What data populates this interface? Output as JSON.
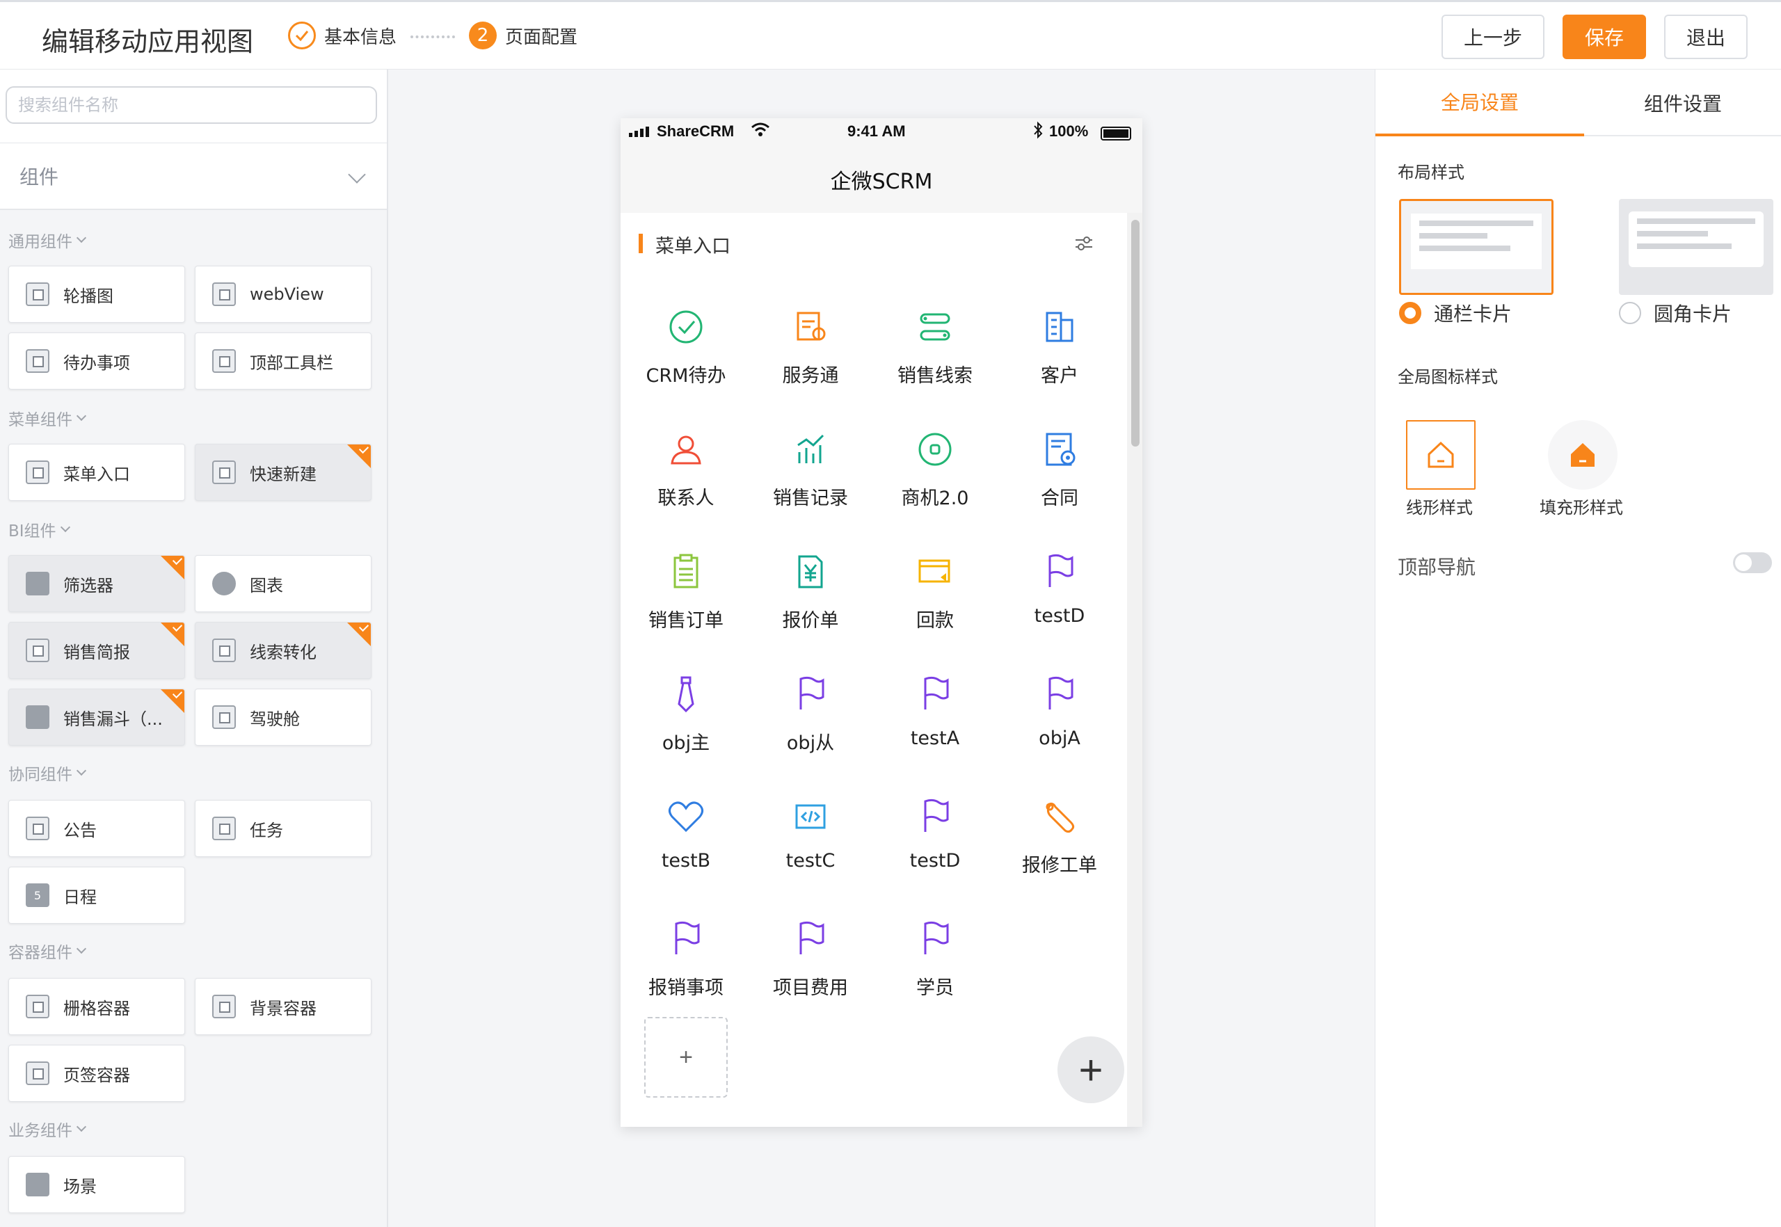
{
  "header": {
    "title": "编辑移动应用视图",
    "steps": [
      {
        "num": "",
        "label": "基本信息"
      },
      {
        "num": "2",
        "label": "页面配置"
      }
    ],
    "buttons": {
      "prev": "上一步",
      "save": "保存",
      "exit": "退出"
    }
  },
  "left": {
    "search_placeholder": "搜索组件名称",
    "select_value": "组件",
    "groups": [
      {
        "label": "通用组件",
        "items": [
          "轮播图",
          "webView",
          "待办事项",
          "顶部工具栏"
        ]
      },
      {
        "label": "菜单组件",
        "items": [
          "菜单入口",
          "快速新建"
        ]
      },
      {
        "label": "BI组件",
        "items": [
          "筛选器",
          "图表",
          "销售简报",
          "线索转化",
          "销售漏斗（...",
          "驾驶舱"
        ]
      },
      {
        "label": "协同组件",
        "items": [
          "公告",
          "任务",
          "日程"
        ]
      },
      {
        "label": "容器组件",
        "items": [
          "栅格容器",
          "背景容器",
          "页签容器"
        ]
      },
      {
        "label": "业务组件",
        "items": [
          "场景"
        ]
      }
    ],
    "calendar_day": "5"
  },
  "phone": {
    "carrier": "ShareCRM",
    "time": "9:41 AM",
    "battery": "100%",
    "app_title": "企微SCRM",
    "menu_title": "菜单入口",
    "items": [
      "CRM待办",
      "服务通",
      "销售线索",
      "客户",
      "联系人",
      "销售记录",
      "商机2.0",
      "合同",
      "销售订单",
      "报价单",
      "回款",
      "testD",
      "obj主",
      "obj从",
      "testA",
      "objA",
      "testB",
      "testC",
      "testD",
      "报修工单",
      "报销事项",
      "项目费用",
      "学员"
    ],
    "add_label": "+",
    "fab_label": "+"
  },
  "right": {
    "tabs": [
      "全局设置",
      "组件设置"
    ],
    "layout_title": "布局样式",
    "layout_options": [
      "通栏卡片",
      "圆角卡片"
    ],
    "icon_style_title": "全局图标样式",
    "icon_styles": [
      "线形样式",
      "填充形样式"
    ],
    "top_nav_label": "顶部导航"
  },
  "colors": {
    "accent": "#f8851a",
    "green": "#22b573",
    "blue": "#2f7de1",
    "purple": "#7b3fe4",
    "red": "#f04e37",
    "teal": "#12a58f",
    "yellow": "#f6b300"
  }
}
